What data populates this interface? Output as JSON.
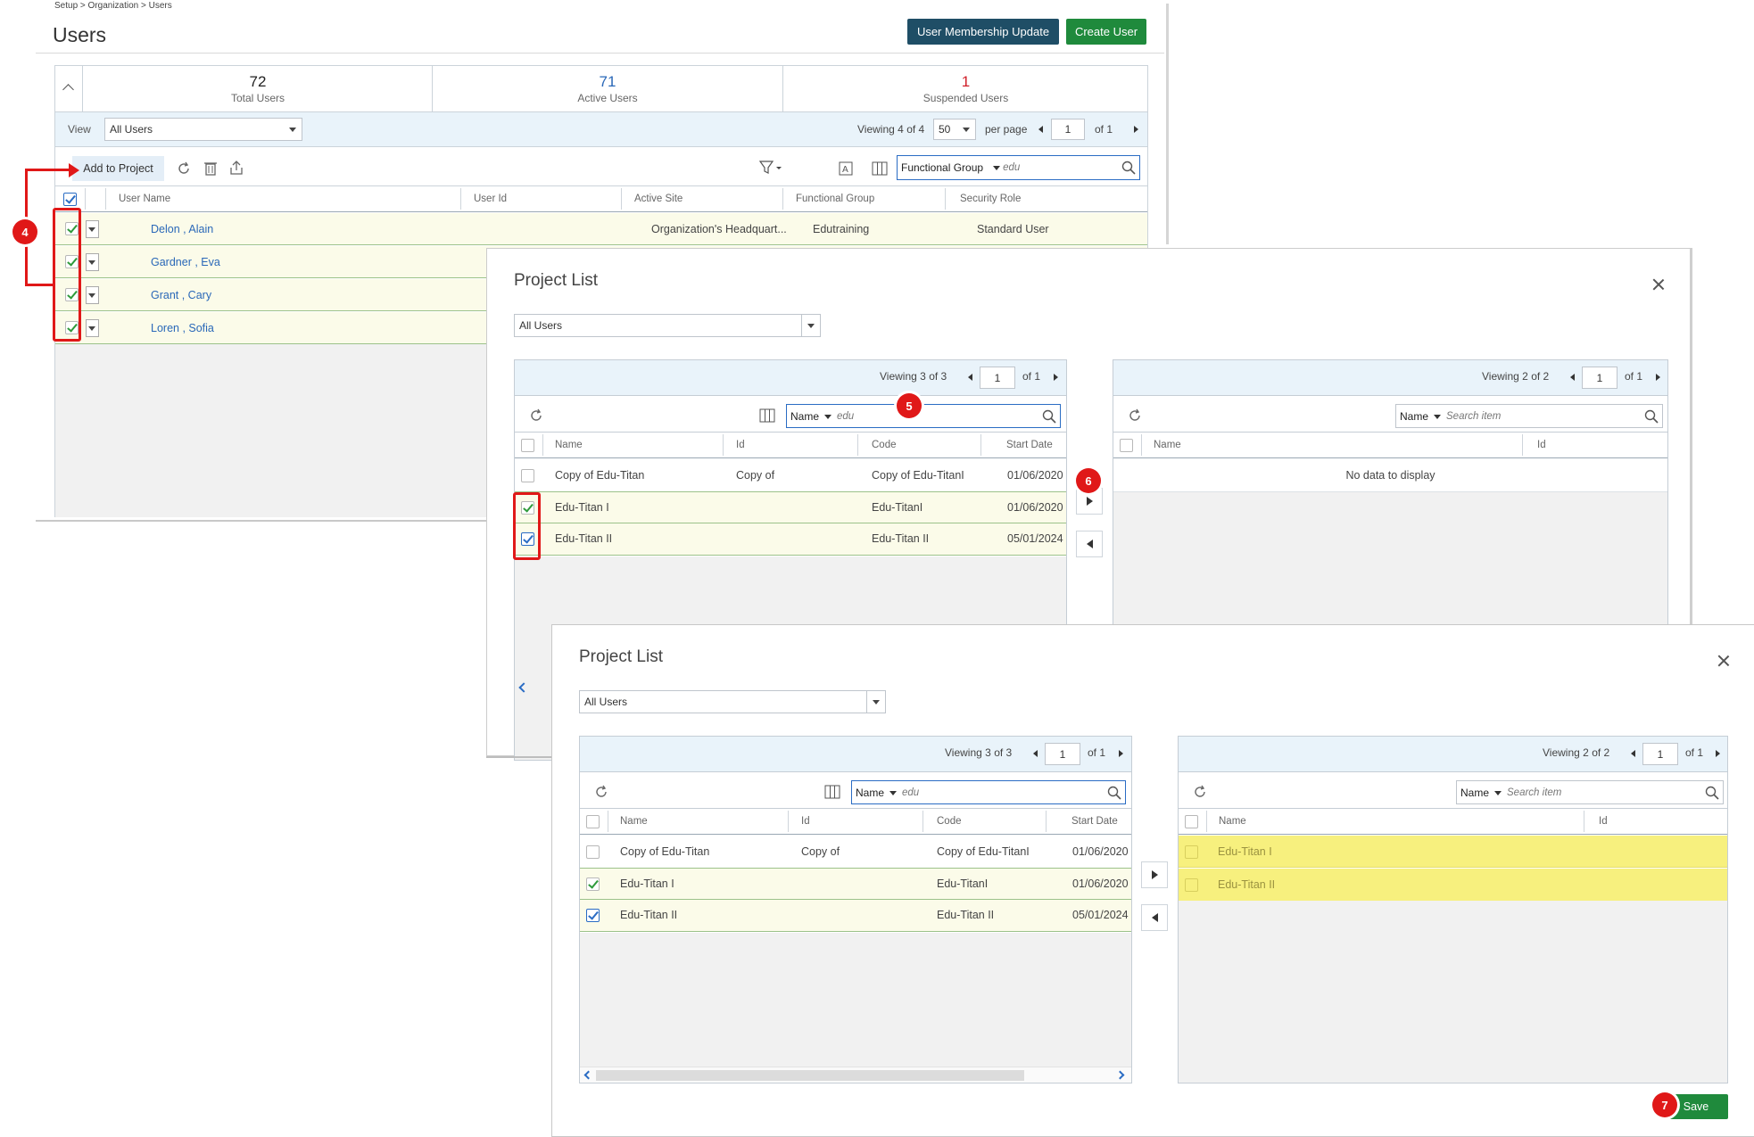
{
  "breadcrumb": "Setup > Organization > Users",
  "page_title": "Users",
  "header_buttons": {
    "membership": "User Membership Update",
    "create": "Create User"
  },
  "stats": [
    {
      "value": "72",
      "label": "Total Users",
      "color": "#222222"
    },
    {
      "value": "71",
      "label": "Active Users",
      "color": "#2a68b8"
    },
    {
      "value": "1",
      "label": "Suspended Users",
      "color": "#d0202a"
    }
  ],
  "view_bar": {
    "view_label": "View",
    "view_value": "All Users",
    "viewing_prefix": "Viewing",
    "viewing_count": "4",
    "viewing_of": "of 4",
    "per_page_value": "50",
    "per_page_label": "per page",
    "page": "1",
    "of_pages": "of 1"
  },
  "toolbar": {
    "add_to_project": "Add to Project",
    "search_field": "Functional Group",
    "search_value": "edu"
  },
  "users_table": {
    "headers": [
      "User Name",
      "User Id",
      "Active Site",
      "Functional Group",
      "Security Role"
    ],
    "rows": [
      {
        "name": "Delon , Alain",
        "active_site": "Organization's Headquart...",
        "functional_group": "Edutraining",
        "security_role": "Standard User"
      },
      {
        "name": "Gardner , Eva"
      },
      {
        "name": "Grant , Cary"
      },
      {
        "name": "Loren , Sofia"
      }
    ]
  },
  "modal": {
    "title": "Project List",
    "filter_value": "All Users",
    "left": {
      "viewing": "Viewing",
      "count": "3",
      "of": "of 3",
      "page": "1",
      "of_pages": "of 1",
      "search_field": "Name",
      "search_value": "edu",
      "headers": [
        "Name",
        "Id",
        "Code",
        "Start Date"
      ],
      "rows": [
        {
          "name": "Copy of Edu-Titan",
          "id": "Copy of",
          "code": "Copy of Edu-TitanI",
          "start": "01/06/2020"
        },
        {
          "name": "Edu-Titan I",
          "id": "",
          "code": "Edu-TitanI",
          "start": "01/06/2020"
        },
        {
          "name": "Edu-Titan II",
          "id": "",
          "code": "Edu-Titan II",
          "start": "05/01/2024"
        }
      ]
    },
    "right": {
      "viewing": "Viewing",
      "count": "2",
      "of": "of 2",
      "page": "1",
      "of_pages": "of 1",
      "search_field": "Name",
      "search_placeholder": "Search item",
      "headers": [
        "Name",
        "Id"
      ],
      "empty": "No data to display",
      "rows": [
        {
          "name": "Edu-Titan I"
        },
        {
          "name": "Edu-Titan II"
        }
      ]
    },
    "save": "Save"
  },
  "badges": [
    "4",
    "5",
    "6",
    "7"
  ],
  "colors": {
    "selected_row": "#fbfbe9",
    "highlight_row": "#f7f07e",
    "callout": "#e01818",
    "header_band": "#e9f3fa"
  }
}
